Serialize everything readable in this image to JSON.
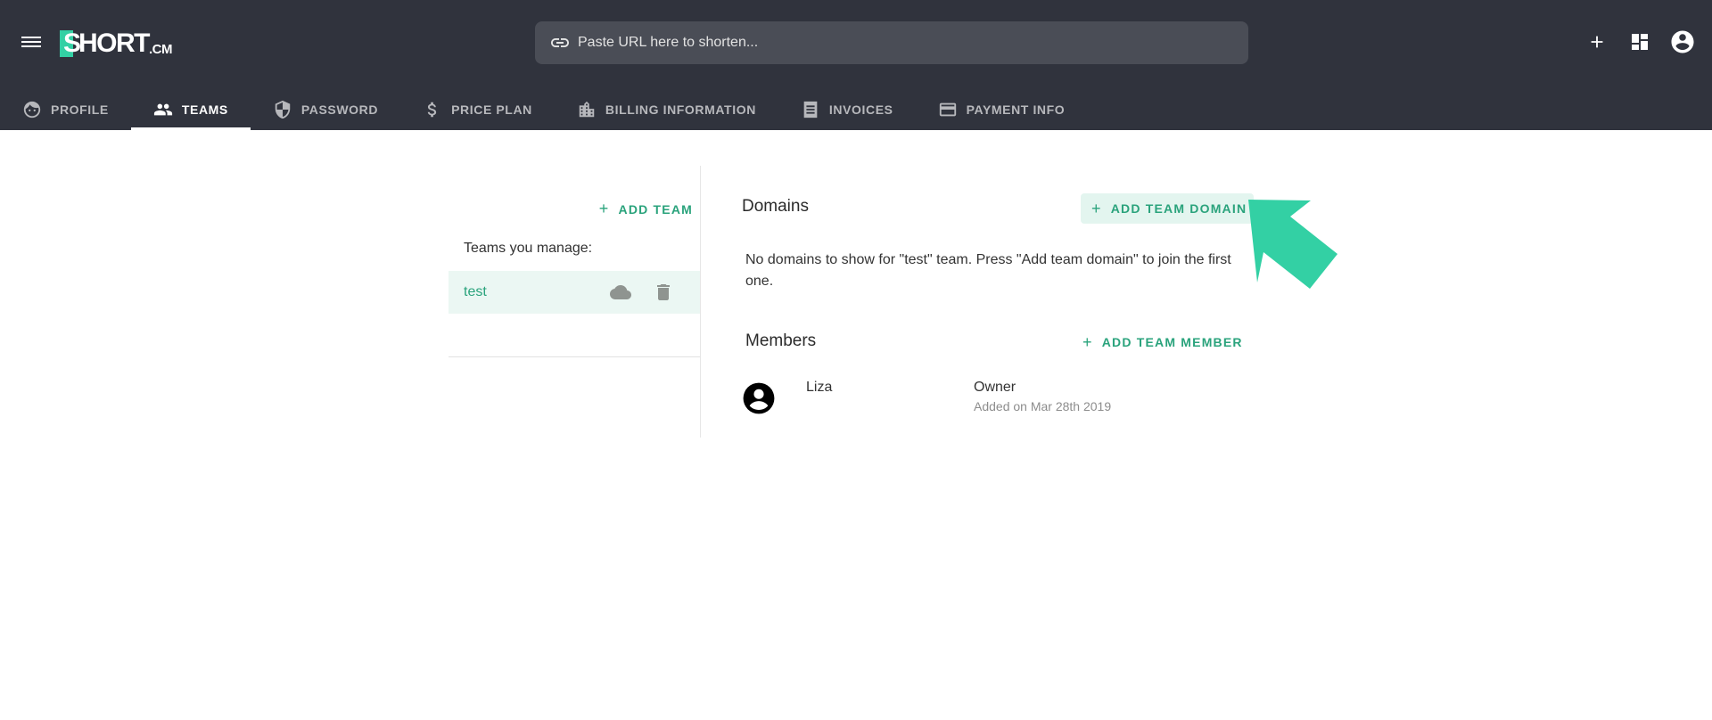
{
  "header": {
    "logo": {
      "mark": "S",
      "text": "HORT",
      "suffix": ".CM"
    },
    "search": {
      "placeholder": "Paste URL here to shorten...",
      "value": ""
    },
    "icons": [
      "add-icon",
      "dashboard-icon",
      "account-icon"
    ]
  },
  "tabs": [
    {
      "label": "PROFILE",
      "icon": "face-icon",
      "active": false
    },
    {
      "label": "TEAMS",
      "icon": "people-icon",
      "active": true
    },
    {
      "label": "PASSWORD",
      "icon": "shield-icon",
      "active": false
    },
    {
      "label": "PRICE PLAN",
      "icon": "dollar-icon",
      "active": false
    },
    {
      "label": "BILLING INFORMATION",
      "icon": "building-icon",
      "active": false
    },
    {
      "label": "INVOICES",
      "icon": "receipt-icon",
      "active": false
    },
    {
      "label": "PAYMENT INFO",
      "icon": "credit-card-icon",
      "active": false
    }
  ],
  "teams_panel": {
    "add_team_label": "ADD TEAM",
    "teams_label": "Teams you manage:",
    "teams": [
      {
        "name": "test",
        "selected": true
      }
    ]
  },
  "domains": {
    "title": "Domains",
    "add_label": "ADD TEAM DOMAIN",
    "empty_message": "No domains to show for \"test\" team. Press \"Add team domain\" to join the first one."
  },
  "members": {
    "title": "Members",
    "add_label": "ADD TEAM MEMBER",
    "list": [
      {
        "name": "Liza",
        "role": "Owner",
        "added": "Added on Mar 28th 2019"
      }
    ]
  },
  "colors": {
    "header_bg": "#30333d",
    "accent": "#2aa37c",
    "brand_green": "#33d0a4",
    "selected_row_bg": "#ebf7f3"
  }
}
